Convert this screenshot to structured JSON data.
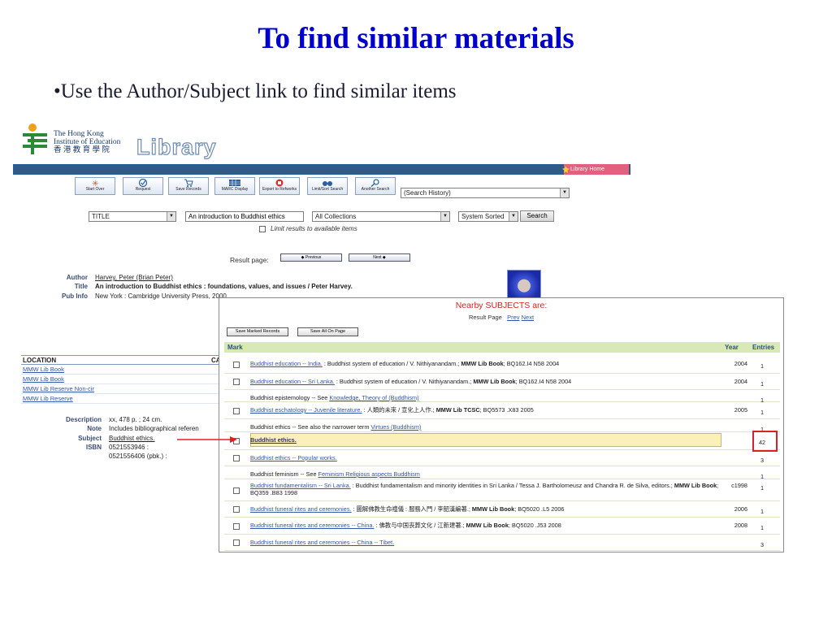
{
  "slide": {
    "title": "To find similar materials",
    "bullet": "•Use the Author/Subject link to find similar items"
  },
  "logo": {
    "line1": "The Hong Kong",
    "line2": "Institute of Education",
    "line3": "香 港 教 育 學 院",
    "library": "Library"
  },
  "navbar": {
    "library_home": "Library Home"
  },
  "toolbar": {
    "buttons": [
      "Start Over",
      "Request",
      "Save Records",
      "MARC Display",
      "Export to Refworks",
      "Limit/Sort Search",
      "Another Search"
    ],
    "history_select": "(Search History)"
  },
  "search": {
    "field": "TITLE",
    "query": "An introduction to Buddhist ethics",
    "collection": "All Collections",
    "sort": "System Sorted",
    "search_button": "Search",
    "limit_label": "Limit results to available items"
  },
  "result_page": {
    "label": "Result page:",
    "previous": "Previous",
    "next": "Next"
  },
  "record": {
    "author_label": "Author",
    "author": "Harvey, Peter (Brian Peter)",
    "title_label": "Title",
    "title": "An introduction to Buddhist ethics : foundations, values, and issues / Peter Harvey.",
    "pubinfo_label": "Pub Info",
    "pubinfo": "New York : Cambridge University Press, 2000.",
    "description_label": "Description",
    "description": "xx, 478 p. ; 24 cm.",
    "note_label": "Note",
    "note": "Includes bibliographical referen",
    "subject_label": "Subject",
    "subject": "Buddhist ethics.",
    "isbn_label": "ISBN",
    "isbn1": "0521553946 :",
    "isbn2": "0521556406 (pbk.) :"
  },
  "location_table": {
    "headers": [
      "LOCATION",
      "CA"
    ],
    "rows": [
      "MMW Lib Book",
      "MMW Lib Book",
      "MMW Lib Reserve Non-cir",
      "MMW Lib Reserve"
    ]
  },
  "popup": {
    "title": "Nearby SUBJECTS are:",
    "result_page": "Result Page",
    "prev": "Prev",
    "next": "Next",
    "save_marked": "Save Marked Records",
    "save_all": "Save All On Page",
    "headers": {
      "mark": "Mark",
      "year": "Year",
      "entries": "Entries"
    },
    "rows": [
      {
        "link": "Buddhist education -- India.",
        "rest": " : Buddhist system of education / V. Nithiyanandam.; ",
        "bold": "MMW Lib Book",
        "tail": "; BQ162.I4 N58 2004",
        "year": "2004",
        "entries": "1",
        "check": true
      },
      {
        "link": "Buddhist education -- Sri Lanka.",
        "rest": " : Buddhist system of education / V. Nithiyanandam.; ",
        "bold": "MMW Lib Book",
        "tail": "; BQ162.I4 N58 2004",
        "year": "2004",
        "entries": "1",
        "check": true
      },
      {
        "pre": "Buddhist epistemology -- See ",
        "link": "Knowledge, Theory of (Buddhism)",
        "year": "",
        "entries": "1",
        "check": false
      },
      {
        "link": "Buddhist eschatology -- Juvenile literature.",
        "rest": " : 人類的未來 / 宣化上人作.; ",
        "bold": "MMW Lib TCSC",
        "tail": "; BQ5573 .X83 2005",
        "year": "2005",
        "entries": "1",
        "check": true
      },
      {
        "pre": "Buddhist ethics -- See also the narrower term ",
        "link": "Virtues (Buddhism)",
        "year": "",
        "entries": "1",
        "check": false
      },
      {
        "link": "Buddhist ethics.",
        "year": "",
        "entries": "42",
        "check": true,
        "highlight": true
      },
      {
        "link": "Buddhist ethics -- Popular works.",
        "year": "",
        "entries": "3",
        "check": true
      },
      {
        "pre": "Buddhist feminism -- See ",
        "link": "Feminism Religious aspects Buddhism",
        "year": "",
        "entries": "1",
        "check": false
      },
      {
        "link": "Buddhist fundamentalism -- Sri Lanka.",
        "rest": " : Buddhist fundamentalism and minority identities in Sri Lanka / Tessa J. Bartholomeusz and Chandra R. de Silva, editors.; ",
        "bold": "MMW Lib Book",
        "tail": "; BQ359 .B83 1998",
        "year": "c1998",
        "entries": "1",
        "check": true
      },
      {
        "link": "Buddhist funeral rites and ceremonies.",
        "rest": " : 圖解佛教生命禮儀 : 服務入門 / 李韶漢編著.; ",
        "bold": "MMW Lib Book",
        "tail": "; BQ5020 .L5 2006",
        "year": "2006",
        "entries": "1",
        "check": true
      },
      {
        "link": "Buddhist funeral rites and ceremonies -- China.",
        "rest": " : 佛教与中国丧葬文化 / 江新建著.; ",
        "bold": "MMW Lib Book",
        "tail": "; BQ5020 .J53 2008",
        "year": "2008",
        "entries": "1",
        "check": true
      },
      {
        "link": "Buddhist funeral rites and ceremonies -- China -- Tibet.",
        "year": "",
        "entries": "3",
        "check": true
      }
    ]
  },
  "colors": {
    "title": "#0000cc",
    "navbar": "#2e5b8a",
    "header_row": "#d8e9b5",
    "highlight": "#faf0b8",
    "annotation": "#e02020"
  }
}
